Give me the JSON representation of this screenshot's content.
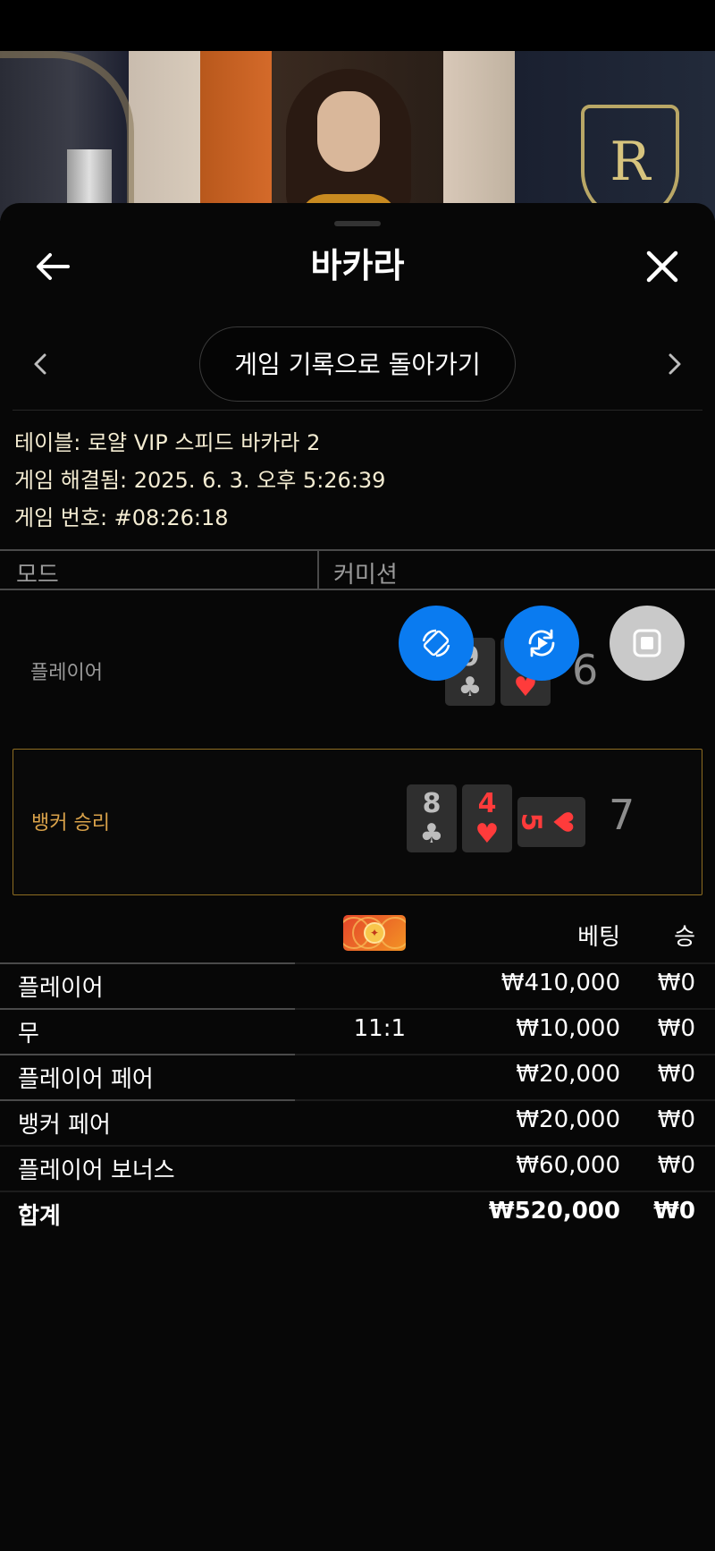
{
  "app": {
    "title": "바카라"
  },
  "nav": {
    "history_button": "게임 기록으로 돌아가기"
  },
  "game_info": {
    "table": "테이블: 로얄 VIP 스피드 바카라 2",
    "resolved": "게임 해결됨: 2025. 6. 3. 오후 5:26:39",
    "round_id": "게임 번호: #08:26:18"
  },
  "mode_header": {
    "mode": "모드",
    "commission": "커미션"
  },
  "results": {
    "player": {
      "label": "플레이어",
      "cards": [
        {
          "rank": "9",
          "suit": "♣",
          "color": "black"
        },
        {
          "rank": "7",
          "suit": "♥",
          "color": "red"
        }
      ],
      "score": "6"
    },
    "banker": {
      "label": "뱅커 승리",
      "label_color": "#d9a24a",
      "cards": [
        {
          "rank": "8",
          "suit": "♣",
          "color": "black"
        },
        {
          "rank": "4",
          "suit": "♥",
          "color": "red"
        },
        {
          "rank": "5",
          "suit": "♥",
          "color": "red"
        }
      ],
      "score": "7"
    }
  },
  "floating_buttons": [
    {
      "icon": "rotate-screen-icon",
      "color": "#0a7bf0"
    },
    {
      "icon": "replay-icon",
      "color": "#0a7bf0"
    },
    {
      "icon": "stop-icon",
      "color": "#c9c9c9"
    }
  ],
  "bets": {
    "headers": {
      "bet": "베팅",
      "win": "승"
    },
    "rows": [
      {
        "name": "플레이어",
        "odds": "",
        "bet": "₩410,000",
        "win": "₩0"
      },
      {
        "name": "무",
        "odds": "11:1",
        "bet": "₩10,000",
        "win": "₩0"
      },
      {
        "name": "플레이어 페어",
        "odds": "",
        "bet": "₩20,000",
        "win": "₩0"
      },
      {
        "name": "뱅커 페어",
        "odds": "",
        "bet": "₩20,000",
        "win": "₩0"
      },
      {
        "name": "플레이어 보너스",
        "odds": "",
        "bet": "₩60,000",
        "win": "₩0"
      }
    ],
    "total": {
      "name": "합계",
      "bet": "₩520,000",
      "win": "₩0"
    }
  }
}
